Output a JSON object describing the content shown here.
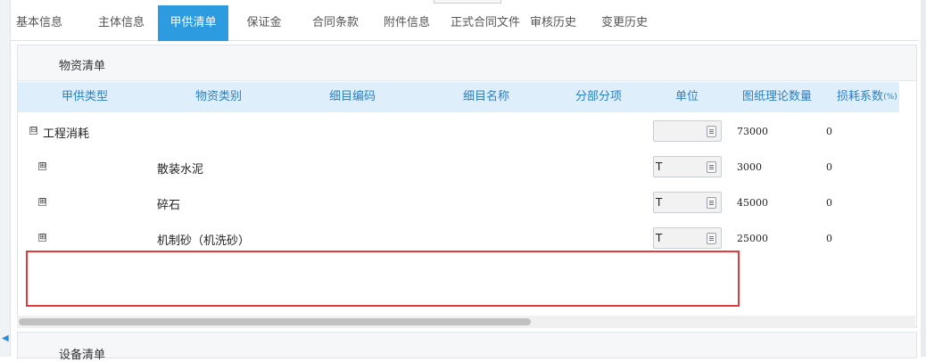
{
  "tabs": [
    {
      "label": "基本信息"
    },
    {
      "label": "主体信息"
    },
    {
      "label": "甲供清单"
    },
    {
      "label": "保证金"
    },
    {
      "label": "合同条款"
    },
    {
      "label": "附件信息"
    },
    {
      "label": "正式合同文件"
    },
    {
      "label": "审核历史"
    },
    {
      "label": "变更历史"
    }
  ],
  "material_panel": {
    "title": "物资清单",
    "columns": [
      "甲供类型",
      "物资类别",
      "细目编码",
      "细目名称",
      "分部分项",
      "单位",
      "图纸理论数量",
      "损耗系数"
    ],
    "loss_suffix": "(%)",
    "rows": [
      {
        "toggle": "⊟",
        "type": "工程消耗",
        "category": "",
        "unit": "",
        "quantity": "73000",
        "loss": "0"
      },
      {
        "toggle": "⊞",
        "type": "",
        "category": "散装水泥",
        "unit": "T",
        "quantity": "3000",
        "loss": "0"
      },
      {
        "toggle": "⊞",
        "type": "",
        "category": "碎石",
        "unit": "T",
        "quantity": "45000",
        "loss": "0"
      },
      {
        "toggle": "⊞",
        "type": "",
        "category": "机制砂（机洗砂）",
        "unit": "T",
        "quantity": "25000",
        "loss": "0"
      }
    ]
  },
  "equipment_panel": {
    "title": "设备清单"
  },
  "colors": {
    "accent": "#2d9be0",
    "header_bg": "#deeffb",
    "highlight": "#e5393b"
  }
}
